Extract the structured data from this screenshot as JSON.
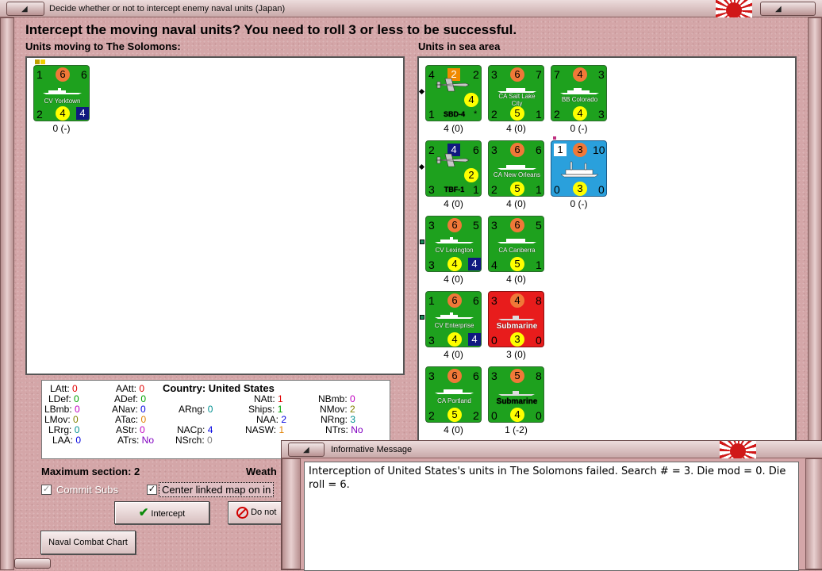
{
  "window": {
    "title": "Decide whether or not to intercept enemy naval units (Japan)"
  },
  "heading": "Intercept the moving naval units?  You need to roll 3 or less to be successful.",
  "left_panel": {
    "label": "Units moving to The Solomons:",
    "units": [
      {
        "name": "CV Yorktown",
        "tl": "1",
        "tc": "6",
        "tr": "6",
        "bl": "2",
        "bc": "4",
        "br": "4",
        "caption": "0 (-)"
      }
    ]
  },
  "right_panel": {
    "label": "Units in sea area",
    "units": [
      {
        "name": "SBD-4",
        "tl": "4",
        "tc": "2",
        "tr": "2",
        "mid": "4",
        "bl": "1",
        "br": "*",
        "caption": "4 (0)"
      },
      {
        "name": "CA Salt Lake City",
        "tl": "3",
        "tc": "6",
        "tr": "7",
        "bl": "2",
        "bc": "5",
        "br": "1",
        "caption": "4 (0)"
      },
      {
        "name": "BB Colorado",
        "tl": "7",
        "tc": "4",
        "tr": "3",
        "bl": "2",
        "bc": "4",
        "br": "3",
        "caption": "0 (-)"
      },
      {
        "name": "TBF-1",
        "tl": "2",
        "tc": "4",
        "tr": "6",
        "mid": "2",
        "bl": "3",
        "br": "1",
        "caption": "4 (0)"
      },
      {
        "name": "CA New Orleans",
        "tl": "3",
        "tc": "6",
        "tr": "6",
        "bl": "2",
        "bc": "5",
        "br": "1",
        "caption": "4 (0)"
      },
      {
        "name": "",
        "tl": "1",
        "tc": "3",
        "tr": "10",
        "bl": "0",
        "bc": "3",
        "br": "0",
        "caption": "0 (-)"
      },
      {
        "name": "CV Lexington",
        "tl": "3",
        "tc": "6",
        "tr": "5",
        "bl": "3",
        "bc": "4",
        "br": "4",
        "caption": "4 (0)"
      },
      {
        "name": "CA Canberra",
        "tl": "3",
        "tc": "6",
        "tr": "5",
        "bl": "4",
        "bc": "5",
        "br": "1",
        "caption": "4 (0)"
      },
      {
        "name": "CV Enterprise",
        "tl": "1",
        "tc": "6",
        "tr": "6",
        "bl": "3",
        "bc": "4",
        "br": "4",
        "caption": "4 (0)"
      },
      {
        "name": "Submarine",
        "tl": "3",
        "tc": "4",
        "tr": "8",
        "bl": "0",
        "bc": "3",
        "br": "0",
        "caption": "3 (0)"
      },
      {
        "name": "CA Portland",
        "tl": "3",
        "tc": "6",
        "tr": "6",
        "bl": "2",
        "bc": "5",
        "br": "2",
        "caption": "4 (0)"
      },
      {
        "name": "Submarine",
        "tl": "3",
        "tc": "5",
        "tr": "8",
        "bl": "0",
        "bc": "4",
        "br": "0",
        "caption": "1 (-2)"
      }
    ]
  },
  "stats": {
    "country_label": "Country:",
    "country": "United States",
    "LAtt": "0",
    "LDef": "0",
    "LBmb": "0",
    "LMov": "0",
    "LRrg": "0",
    "LAA": "0",
    "AAtt": "0",
    "ADef": "0",
    "ANav": "0",
    "ATac": "0",
    "AStr": "0",
    "ATrs": "No",
    "ARng": "0",
    "NACp": "4",
    "NSrch": "0",
    "NAtt": "1",
    "Ships": "1",
    "NAA": "2",
    "NASW": "1",
    "NBmb": "0",
    "NMov": "2",
    "NRng": "3",
    "NTrs": "No"
  },
  "bottom": {
    "max_section": "Maximum section: 2",
    "weather": "Weath",
    "commit_subs": "Commit Subs",
    "center_linked": "Center linked map on in",
    "intercept_btn": "Intercept",
    "do_not_btn": "Do not",
    "chart_btn": "Naval Combat Chart"
  },
  "message": {
    "title": "Informative Message",
    "text": "Interception of United States's units in The Solomons failed.  Search # = 3.  Die mod = 0.  Die roll = 6."
  },
  "colors": {
    "counter_green": "#1ea11e",
    "counter_red": "#e81c1c",
    "counter_blue": "#2aa0dc"
  }
}
